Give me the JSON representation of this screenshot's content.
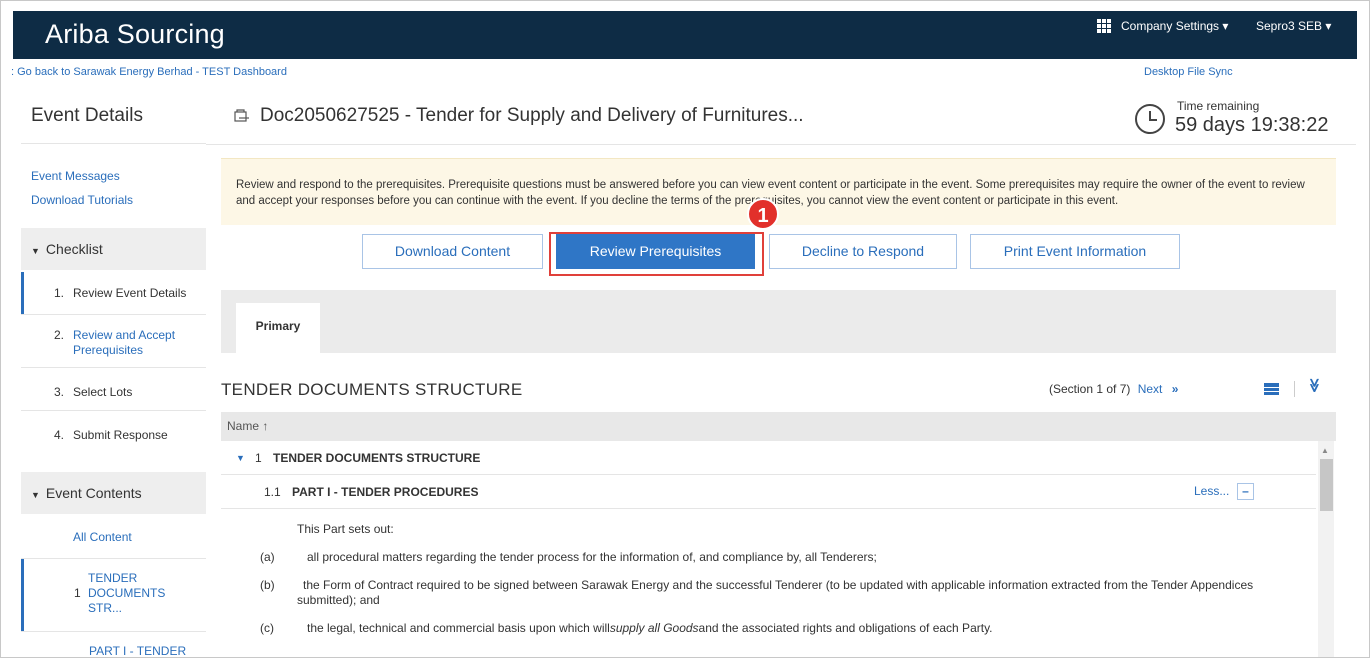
{
  "header": {
    "brand": "Ariba Sourcing",
    "company_settings": "Company Settings ▾",
    "user": "Sepro3 SEB ▾"
  },
  "backlink": ": Go back to Sarawak Energy Berhad - TEST Dashboard",
  "desktop_file_sync": "Desktop File Sync",
  "sidebar": {
    "title": "Event Details",
    "links": [
      "Event Messages",
      "Download Tutorials"
    ],
    "checklist_label": "Checklist",
    "steps": [
      {
        "num": "1.",
        "label": "Review Event Details"
      },
      {
        "num": "2.",
        "label": "Review and Accept Prerequisites"
      },
      {
        "num": "3.",
        "label": "Select Lots"
      },
      {
        "num": "4.",
        "label": "Submit Response"
      }
    ],
    "event_contents_label": "Event Contents",
    "all_content": "All Content",
    "content_items": [
      {
        "num": "1",
        "label": "TENDER DOCUMENTS STR..."
      },
      {
        "num": "",
        "label": "PART I - TENDER"
      }
    ]
  },
  "main": {
    "doc_title": "Doc2050627525 - Tender for Supply and Delivery of Furnitures...",
    "time_label": "Time remaining",
    "time_value": "59 days 19:38:22",
    "notice": "Review and respond to the prerequisites. Prerequisite questions must be answered before you can view event content or participate in the event. Some prerequisites may require the owner of the event to review and accept your responses before you can continue with the event. If you decline the terms of the prerequisites, you cannot view the event content or participate in this event.",
    "buttons": {
      "download": "Download Content",
      "review": "Review Prerequisites",
      "decline": "Decline to Respond",
      "print": "Print Event Information"
    },
    "callout_number": "1",
    "tab_primary": "Primary",
    "structure_title": "TENDER DOCUMENTS STRUCTURE",
    "section_info": "(Section 1 of 7)",
    "next_label": "Next",
    "next_chevron": "»",
    "collapse_glyph": "≫",
    "column_name": "Name ↑",
    "row1_num": "1",
    "row1_label": "TENDER DOCUMENTS STRUCTURE",
    "row2_num": "1.1",
    "row2_label": "PART I - TENDER PROCEDURES",
    "less_label": "Less...",
    "minus_glyph": "–",
    "intro": "This Part sets out:",
    "items": [
      {
        "mark": "(a)",
        "text": "all procedural matters regarding the tender process for the information of, and compliance by, all Tenderers;"
      },
      {
        "mark": "(b)",
        "text": "the Form of Contract required to be signed between Sarawak Energy and the successful Tenderer (to be updated with applicable information extracted from the Tender Appendices submitted); and"
      },
      {
        "mark": "(c)",
        "text_before": "the legal, technical and commercial basis upon which will",
        "text_italic": "supply all Goods",
        "text_after": "and the associated rights and obligations of each Party."
      }
    ]
  }
}
